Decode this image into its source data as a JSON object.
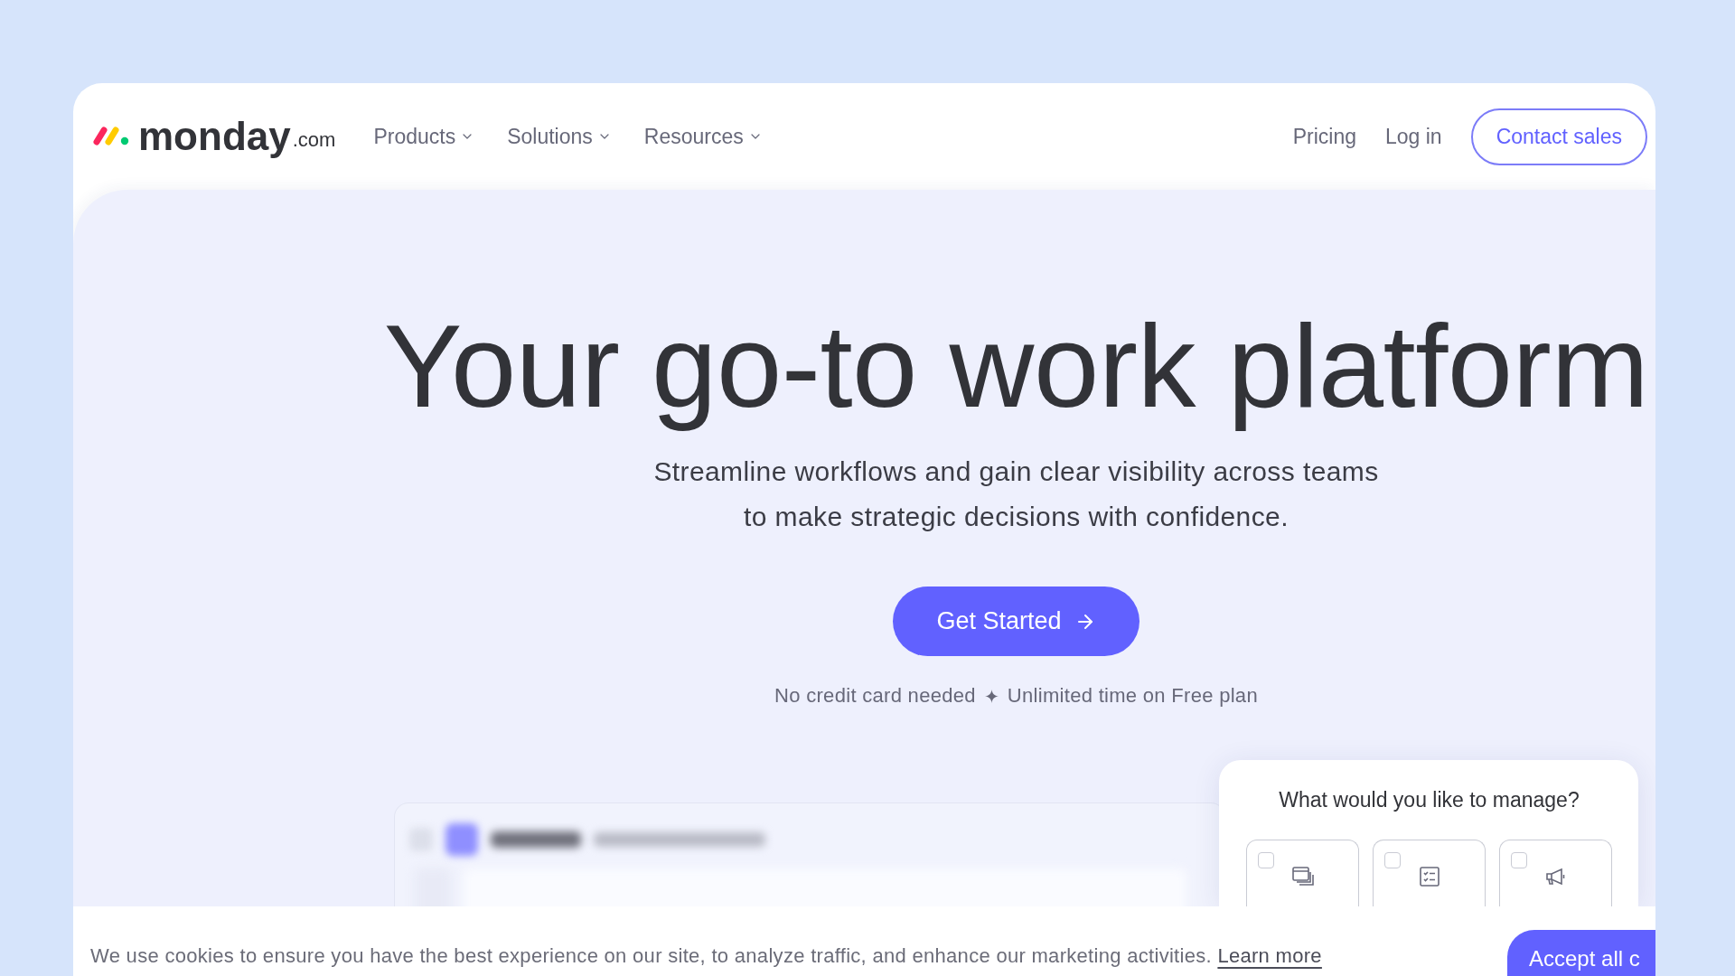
{
  "nav": {
    "logo": {
      "name": "monday",
      "suffix": ".com"
    },
    "menus": [
      {
        "label": "Products"
      },
      {
        "label": "Solutions"
      },
      {
        "label": "Resources"
      }
    ],
    "links": [
      "Pricing",
      "Log in"
    ],
    "contact_button": "Contact sales"
  },
  "hero": {
    "title": "Your go-to work platform",
    "subtitle_lines": [
      "Streamline workflows and gain clear visibility across teams",
      "to make strategic decisions with confidence."
    ],
    "cta": "Get Started",
    "notes": [
      "No credit card needed",
      "Unlimited time on Free plan"
    ]
  },
  "manage_widget": {
    "title": "What would you like to manage?",
    "options": [
      {
        "checked": false
      },
      {
        "checked": false
      },
      {
        "checked": false
      }
    ]
  },
  "cookie_bar": {
    "text": "We use cookies to ensure you have the best experience on our site, to analyze traffic, and enhance our marketing activities.",
    "link": "Learn more",
    "accept_button": "Accept all c"
  }
}
